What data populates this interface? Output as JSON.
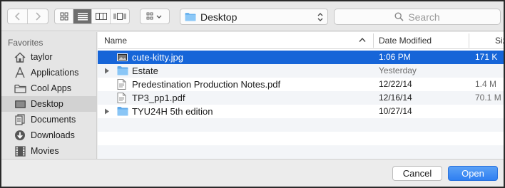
{
  "toolbar": {
    "path_label": "Desktop",
    "search_placeholder": "Search"
  },
  "sidebar": {
    "heading": "Favorites",
    "items": [
      {
        "label": "taylor",
        "icon": "home-icon"
      },
      {
        "label": "Applications",
        "icon": "applications-icon"
      },
      {
        "label": "Cool Apps",
        "icon": "folder-icon"
      },
      {
        "label": "Desktop",
        "icon": "desktop-icon",
        "selected": true
      },
      {
        "label": "Documents",
        "icon": "documents-icon"
      },
      {
        "label": "Downloads",
        "icon": "downloads-icon"
      },
      {
        "label": "Movies",
        "icon": "movies-icon"
      }
    ]
  },
  "list": {
    "columns": {
      "name": "Name",
      "date": "Date Modified",
      "size": "Siz"
    },
    "rows": [
      {
        "name": "cute-kitty.jpg",
        "date": "1:06 PM",
        "size": "171 K",
        "kind": "image",
        "selected": true
      },
      {
        "name": "Estate",
        "date": "Yesterday",
        "size": "",
        "kind": "folder"
      },
      {
        "name": "Predestination Production Notes.pdf",
        "date": "12/22/14",
        "size": "1.4 M",
        "kind": "pdf"
      },
      {
        "name": "TP3_pp1.pdf",
        "date": "12/16/14",
        "size": "70.1 M",
        "kind": "pdf"
      },
      {
        "name": "TYU24H 5th edition",
        "date": "10/27/14",
        "size": "",
        "kind": "folder"
      }
    ]
  },
  "buttons": {
    "cancel": "Cancel",
    "open": "Open"
  },
  "colors": {
    "selection": "#1665d8",
    "folder": "#6cb4ef",
    "accent_button": "#2f7ff1"
  }
}
